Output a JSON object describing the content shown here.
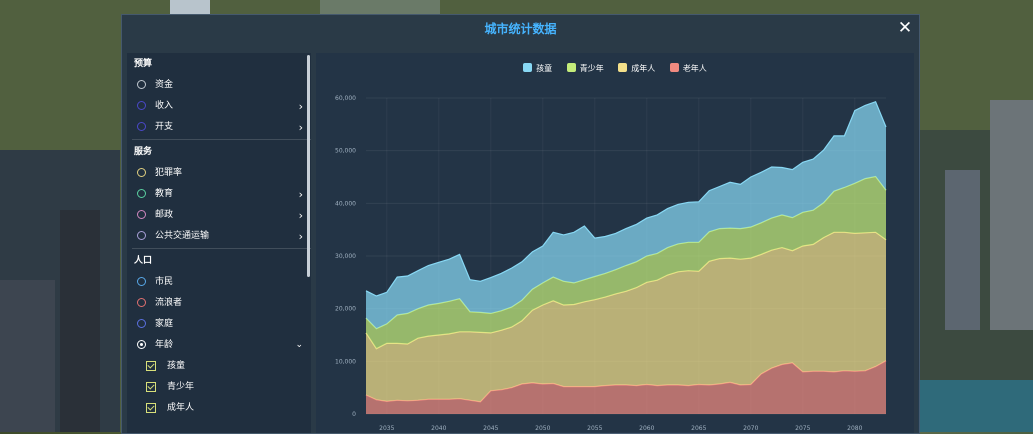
{
  "window": {
    "title": "城市统计数据",
    "close_icon": "close-icon"
  },
  "sidebar": {
    "sections": [
      {
        "label": "预算",
        "items": [
          {
            "label": "资金",
            "color": "#c0c8d0",
            "chevron": false
          },
          {
            "label": "收入",
            "color": "#4a48c8",
            "chevron": true
          },
          {
            "label": "开支",
            "color": "#4a48c8",
            "chevron": true
          }
        ]
      },
      {
        "label": "服务",
        "items": [
          {
            "label": "犯罪率",
            "color": "#e0d080",
            "chevron": false
          },
          {
            "label": "教育",
            "color": "#5ad0a0",
            "chevron": true
          },
          {
            "label": "邮政",
            "color": "#d088c0",
            "chevron": true
          },
          {
            "label": "公共交通运输",
            "color": "#a8a0d8",
            "chevron": true
          }
        ]
      },
      {
        "label": "人口",
        "items": [
          {
            "label": "市民",
            "color": "#58a8e8",
            "chevron": false
          },
          {
            "label": "流浪者",
            "color": "#e07070",
            "chevron": false
          },
          {
            "label": "家庭",
            "color": "#5a70e0",
            "chevron": false
          },
          {
            "label": "年龄",
            "color": "#ffffff",
            "chevron": false,
            "expanded": true,
            "selected": true
          }
        ]
      }
    ],
    "age_subitems": [
      {
        "label": "孩童",
        "checked": true
      },
      {
        "label": "青少年",
        "checked": true
      },
      {
        "label": "成年人",
        "checked": true
      }
    ]
  },
  "chart_data": {
    "type": "area",
    "stacked": true,
    "x": [
      2033,
      2034,
      2035,
      2036,
      2037,
      2038,
      2039,
      2040,
      2041,
      2042,
      2043,
      2044,
      2045,
      2046,
      2047,
      2048,
      2049,
      2050,
      2051,
      2052,
      2053,
      2054,
      2055,
      2056,
      2057,
      2058,
      2059,
      2060,
      2061,
      2062,
      2063,
      2064,
      2065,
      2066,
      2067,
      2068,
      2069,
      2070,
      2071,
      2072,
      2073,
      2074,
      2075,
      2076,
      2077,
      2078,
      2079,
      2080,
      2081,
      2082,
      2083
    ],
    "x_ticks": [
      "2035",
      "2040",
      "2045",
      "2050",
      "2055",
      "2060",
      "2065",
      "2070",
      "2075",
      "2080"
    ],
    "y_ticks": [
      "0",
      "10,000",
      "20,000",
      "30,000",
      "40,000",
      "50,000",
      "60,000"
    ],
    "ylim": [
      0,
      60000
    ],
    "series": [
      {
        "name": "老年人",
        "color": "#f08a80",
        "values": [
          3600,
          2700,
          2400,
          2600,
          2500,
          2600,
          2800,
          2800,
          2800,
          2900,
          2600,
          2300,
          4400,
          4600,
          5000,
          5700,
          5900,
          5700,
          5800,
          5200,
          5200,
          5200,
          5200,
          5400,
          5500,
          5500,
          5400,
          5600,
          5400,
          5500,
          5500,
          5400,
          5600,
          5500,
          5700,
          6000,
          5500,
          5600,
          7600,
          8700,
          9400,
          9700,
          8000,
          8100,
          8100,
          8000,
          8200,
          8100,
          8200,
          9000,
          10100
        ]
      },
      {
        "name": "成年人",
        "color": "#f4e08a",
        "values": [
          11800,
          9700,
          11000,
          10800,
          10800,
          11800,
          12000,
          12200,
          12400,
          12700,
          13000,
          13200,
          11000,
          11300,
          11500,
          12000,
          13800,
          15000,
          15700,
          15500,
          15600,
          16100,
          16500,
          16800,
          17300,
          17800,
          18600,
          19400,
          20000,
          20900,
          21500,
          21800,
          21500,
          23500,
          23800,
          23600,
          23900,
          24000,
          22700,
          22400,
          22200,
          21300,
          23900,
          24100,
          25400,
          26500,
          26300,
          26200,
          26200,
          25500,
          23000
        ]
      },
      {
        "name": "青少年",
        "color": "#c4ec7a",
        "values": [
          2800,
          3800,
          3700,
          5400,
          5800,
          5600,
          5900,
          6000,
          6200,
          6300,
          3800,
          3800,
          3700,
          3700,
          3800,
          3900,
          4000,
          4200,
          4500,
          4500,
          4100,
          4200,
          4400,
          4500,
          4600,
          4900,
          4900,
          5000,
          5100,
          5200,
          5300,
          5400,
          5500,
          5600,
          5700,
          5700,
          5800,
          5900,
          6000,
          6100,
          6200,
          6300,
          6400,
          6500,
          6600,
          7800,
          8500,
          9500,
          10300,
          10600,
          9400
        ]
      },
      {
        "name": "孩童",
        "color": "#88d8f4",
        "values": [
          5200,
          6200,
          6000,
          7200,
          7100,
          7200,
          7500,
          7800,
          8000,
          8400,
          6100,
          5900,
          6800,
          7100,
          7400,
          7300,
          7100,
          7000,
          8500,
          8800,
          9600,
          10200,
          7300,
          7000,
          6900,
          7000,
          7100,
          7200,
          7300,
          7400,
          7500,
          7600,
          7700,
          7800,
          8000,
          8700,
          8400,
          9500,
          9600,
          9700,
          9000,
          9100,
          9500,
          9700,
          10000,
          10500,
          9800,
          13800,
          13900,
          14200,
          12000
        ]
      }
    ],
    "legend_order": [
      "孩童",
      "青少年",
      "成年人",
      "老年人"
    ]
  }
}
